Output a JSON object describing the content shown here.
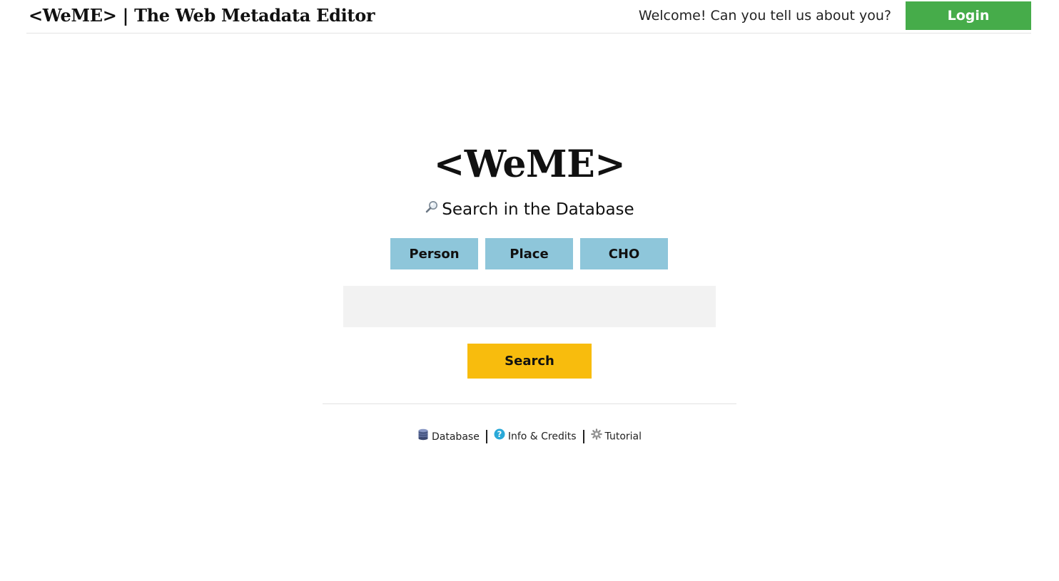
{
  "header": {
    "brand": "<WeME> | The Web Metadata Editor",
    "welcome_text": "Welcome! Can you tell us about you?",
    "login_label": "Login"
  },
  "main": {
    "logo": "<WeME>",
    "search_heading": "Search in the Database",
    "search_heading_icon": "magnifier-icon",
    "type_buttons": [
      {
        "label": "Person"
      },
      {
        "label": "Place"
      },
      {
        "label": "CHO"
      }
    ],
    "search_input_value": "",
    "search_button_label": "Search"
  },
  "footer": {
    "links": [
      {
        "label": "Database",
        "icon": "database-icon"
      },
      {
        "label": "Info & Credits",
        "icon": "help-circle-icon"
      },
      {
        "label": "Tutorial",
        "icon": "gear-icon"
      }
    ]
  },
  "colors": {
    "login_green": "#46ac4a",
    "type_button_blue": "#8ec6da",
    "search_button_yellow": "#f8bc0d",
    "input_background": "#f2f2f2"
  }
}
